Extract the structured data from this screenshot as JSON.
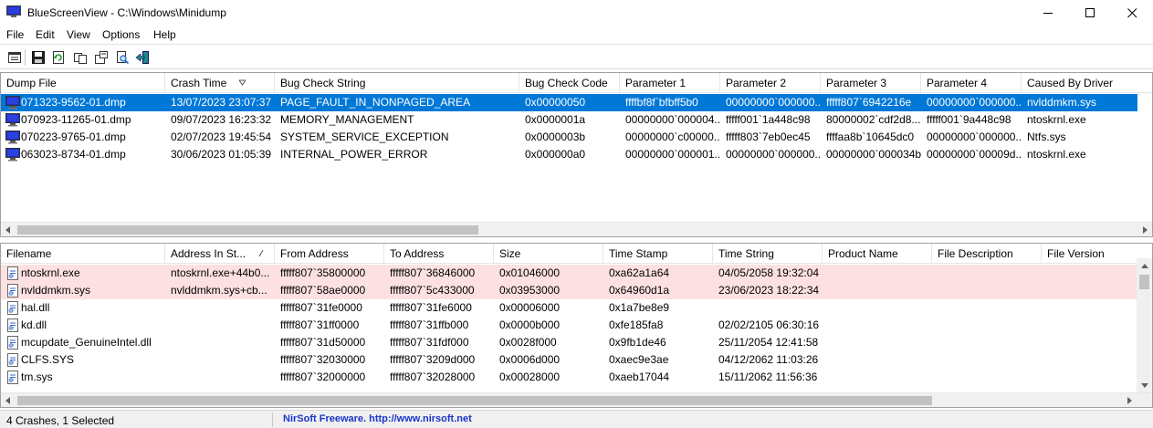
{
  "window": {
    "title": "BlueScreenView  -  C:\\Windows\\Minidump"
  },
  "menu": [
    "File",
    "Edit",
    "View",
    "Options",
    "Help"
  ],
  "toolbar": {
    "icons": [
      "properties-icon",
      "save-icon",
      "refresh-icon",
      "copy-icon",
      "options-icon",
      "find-icon",
      "exit-icon"
    ]
  },
  "crashes": {
    "columns": [
      "Dump File",
      "Crash Time",
      "Bug Check String",
      "Bug Check Code",
      "Parameter 1",
      "Parameter 2",
      "Parameter 3",
      "Parameter 4",
      "Caused By Driver"
    ],
    "sort_column": "Crash Time",
    "rows": [
      [
        "071323-9562-01.dmp",
        "13/07/2023 23:07:37",
        "PAGE_FAULT_IN_NONPAGED_AREA",
        "0x00000050",
        "ffffbf8f`bfbff5b0",
        "00000000`000000...",
        "fffff807`6942216e",
        "00000000`000000...",
        "nvlddmkm.sys"
      ],
      [
        "070923-11265-01.dmp",
        "09/07/2023 16:23:32",
        "MEMORY_MANAGEMENT",
        "0x0000001a",
        "00000000`000004...",
        "fffff001`1a448c98",
        "80000002`cdf2d8...",
        "fffff001`9a448c98",
        "ntoskrnl.exe"
      ],
      [
        "070223-9765-01.dmp",
        "02/07/2023 19:45:54",
        "SYSTEM_SERVICE_EXCEPTION",
        "0x0000003b",
        "00000000`c00000...",
        "fffff803`7eb0ec45",
        "ffffaa8b`10645dc0",
        "00000000`000000...",
        "Ntfs.sys"
      ],
      [
        "063023-8734-01.dmp",
        "30/06/2023 01:05:39",
        "INTERNAL_POWER_ERROR",
        "0x000000a0",
        "00000000`000001...",
        "00000000`000000...",
        "00000000`000034bf",
        "00000000`00009d...",
        "ntoskrnl.exe"
      ]
    ],
    "selected_index": 0
  },
  "drivers": {
    "columns": [
      "Filename",
      "Address In St...",
      "From Address",
      "To Address",
      "Size",
      "Time Stamp",
      "Time String",
      "Product Name",
      "File Description",
      "File Version"
    ],
    "sort_column": "Address In St...",
    "rows": [
      [
        "ntoskrnl.exe",
        "ntoskrnl.exe+44b0...",
        "fffff807`35800000",
        "fffff807`36846000",
        "0x01046000",
        "0xa62a1a64",
        "04/05/2058 19:32:04",
        "",
        "",
        ""
      ],
      [
        "nvlddmkm.sys",
        "nvlddmkm.sys+cb...",
        "fffff807`58ae0000",
        "fffff807`5c433000",
        "0x03953000",
        "0x64960d1a",
        "23/06/2023 18:22:34",
        "",
        "",
        ""
      ],
      [
        "hal.dll",
        "",
        "fffff807`31fe0000",
        "fffff807`31fe6000",
        "0x00006000",
        "0x1a7be8e9",
        "",
        "",
        "",
        ""
      ],
      [
        "kd.dll",
        "",
        "fffff807`31ff0000",
        "fffff807`31ffb000",
        "0x0000b000",
        "0xfe185fa8",
        "02/02/2105 06:30:16",
        "",
        "",
        ""
      ],
      [
        "mcupdate_GenuineIntel.dll",
        "",
        "fffff807`31d50000",
        "fffff807`31fdf000",
        "0x0028f000",
        "0x9fb1de46",
        "25/11/2054 12:41:58",
        "",
        "",
        ""
      ],
      [
        "CLFS.SYS",
        "",
        "fffff807`32030000",
        "fffff807`3209d000",
        "0x0006d000",
        "0xaec9e3ae",
        "04/12/2062 11:03:26",
        "",
        "",
        ""
      ],
      [
        "tm.sys",
        "",
        "fffff807`32000000",
        "fffff807`32028000",
        "0x00028000",
        "0xaeb17044",
        "15/11/2062 11:56:36",
        "",
        "",
        ""
      ]
    ],
    "highlighted_rows": [
      0,
      1
    ]
  },
  "status": {
    "summary": "4 Crashes, 1 Selected",
    "link": "NirSoft Freeware.  http://www.nirsoft.net"
  },
  "colors": {
    "selection": "#0078d7",
    "highlight": "#fde0e1",
    "link": "#1a35c9"
  }
}
